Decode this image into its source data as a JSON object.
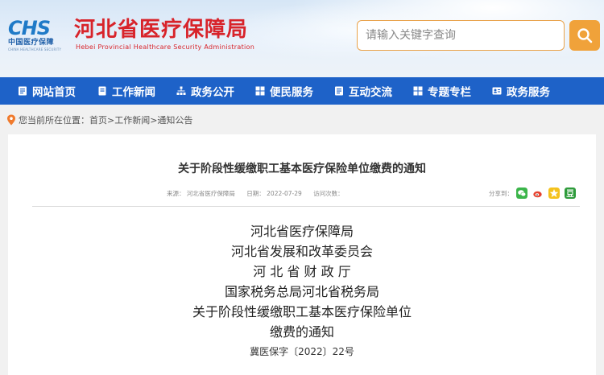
{
  "header": {
    "logo_mark": "CHS",
    "logo_cn": "中国医疗保障",
    "logo_en": "CHINA HEALTHCARE SECURITY",
    "site_title": "河北省医疗保障局",
    "site_subtitle": "Hebei Provincial Healthcare Security Administration",
    "search_placeholder": "请输入关键字查询"
  },
  "nav": {
    "items": [
      {
        "label": "网站首页",
        "icon": "document-icon"
      },
      {
        "label": "工作新闻",
        "icon": "bookmark-icon"
      },
      {
        "label": "政务公开",
        "icon": "org-chart-icon"
      },
      {
        "label": "便民服务",
        "icon": "grid-icon"
      },
      {
        "label": "互动交流",
        "icon": "document-icon"
      },
      {
        "label": "专题专栏",
        "icon": "grid-icon"
      },
      {
        "label": "政务服务",
        "icon": "id-card-icon"
      }
    ]
  },
  "breadcrumb": {
    "text": "您当前所在位置：首页>工作新闻>通知公告"
  },
  "article": {
    "title": "关于阶段性缓缴职工基本医疗保险单位缴费的通知",
    "meta": {
      "source": "来源：  河北省医疗保障局",
      "date": "日期：  2022-07-29",
      "visits": "访问次数："
    },
    "share_label": "分享到：",
    "issuers": [
      "河北省医疗保障局",
      "河北省发展和改革委员会",
      "河 北 省 财 政 厅",
      "国家税务总局河北省税务局",
      "关于阶段性缓缴职工基本医疗保险单位",
      "缴费的通知"
    ],
    "doc_number": "冀医保字〔2022〕22号"
  },
  "colors": {
    "nav_bg": "#1e62c8",
    "title_red": "#d8232a",
    "search_btn": "#f0a23a",
    "wechat": "#3bb54a",
    "weibo": "#e6412e",
    "qzone": "#f4c21c",
    "douban": "#2e9b3b"
  }
}
